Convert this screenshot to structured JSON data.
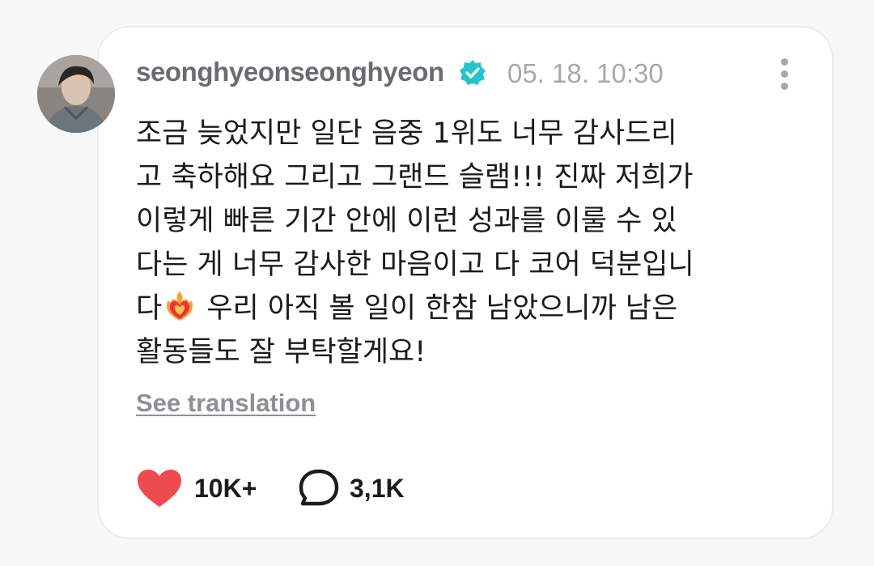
{
  "comment": {
    "author": "seonghyeonseonghyeon",
    "verified_icon": "verified-badge-icon",
    "verified_color": "#27c4c7",
    "timestamp": "05. 18. 10:30",
    "text_lines": [
      "조금 늦었지만 일단 음중 1위도 너무 감사드리",
      "고 축하해요 그리고 그랜드 슬램!!! 진짜 저희가",
      "이렇게 빠른 기간 안에 이런 성과를 이룰 수 있",
      "다는 게 너무 감사한 마음이고 다 코어 덕분입니",
      "우리 아직 볼 일이 한참 남았으니까 남은",
      "활동들도 잘 부탁할게요!"
    ],
    "line5_prefix": "다",
    "emoji": "heart-on-fire-emoji",
    "see_translation": "See translation",
    "likes": {
      "icon": "heart-icon",
      "count": "10K+",
      "color": "#ef4a4d"
    },
    "replies": {
      "icon": "speech-bubble-icon",
      "count": "3,1K"
    },
    "more_icon": "vertical-dots-icon"
  }
}
